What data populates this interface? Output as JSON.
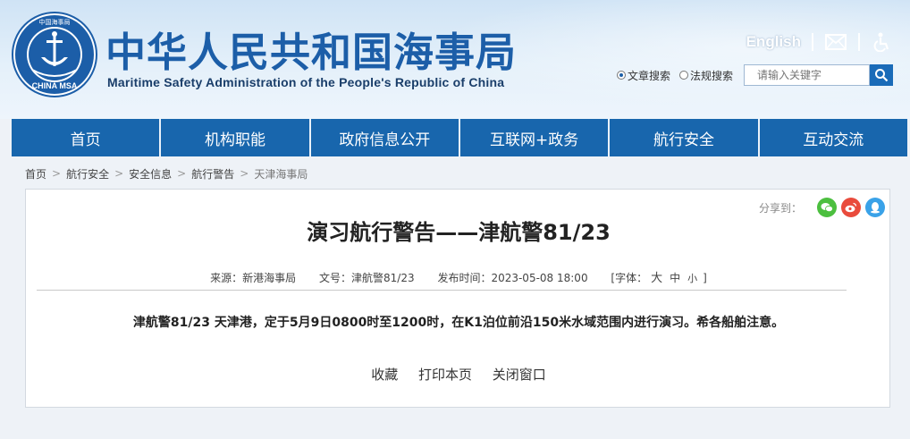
{
  "header": {
    "logo_text": "CHINA MSA",
    "logo_top_text": "中国海事局",
    "title_cn": "中华人民共和国海事局",
    "title_en": "Maritime Safety Administration of the People's Republic of China",
    "english_link": "English",
    "mail_icon": "mail-icon",
    "accessibility_icon": "accessibility-icon",
    "search": {
      "radio_article": "文章搜索",
      "radio_law": "法规搜索",
      "placeholder": "请输入关键字",
      "selected": "文章搜索"
    }
  },
  "nav": {
    "items": [
      "首页",
      "机构职能",
      "政府信息公开",
      "互联网+政务",
      "航行安全",
      "互动交流"
    ]
  },
  "breadcrumb": [
    "首页",
    "航行安全",
    "安全信息",
    "航行警告",
    "天津海事局"
  ],
  "article": {
    "share_label": "分享到：",
    "title": "演习航行警告——津航警81/23",
    "source": "来源：新港海事局",
    "doc_no": "文号：津航警81/23",
    "publish_time": "发布时间：2023-05-08 18:00",
    "font_label_open": "[字体：",
    "font_large": "大",
    "font_medium": "中",
    "font_small": "小",
    "font_label_close": "]",
    "body": "津航警81/23 天津港，定于5月9日0800时至1200时，在K1泊位前沿150米水域范围内进行演习。希各船舶注意。",
    "actions": {
      "collect": "收藏",
      "print": "打印本页",
      "close": "关闭窗口"
    }
  },
  "colors": {
    "nav_bg": "#1866ad",
    "title_blue": "#1c5ea8",
    "wechat": "#4cbf3f",
    "weibo": "#e94b3c",
    "qq": "#3aa2e8"
  }
}
